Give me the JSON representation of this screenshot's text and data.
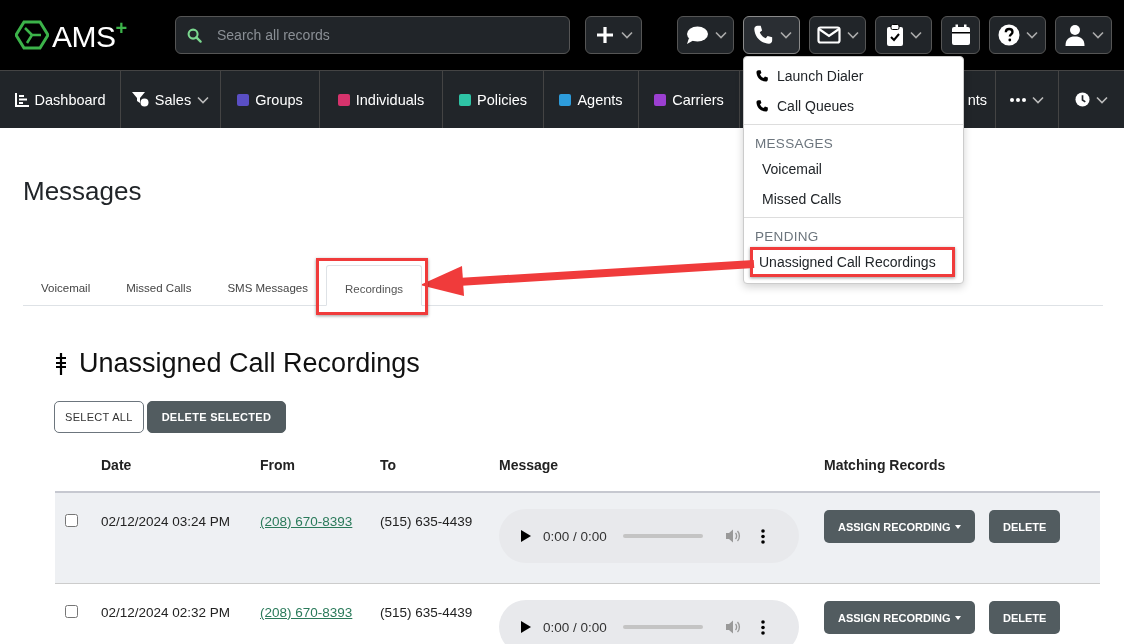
{
  "topbar": {
    "logo": {
      "text": "AMS",
      "sup": "+"
    },
    "search": {
      "placeholder": "Search all records"
    },
    "buttons": [
      {
        "kind": "plus",
        "dropdown": true,
        "expanded": false
      },
      {
        "kind": "chat",
        "dropdown": true,
        "expanded": false
      },
      {
        "kind": "phone",
        "dropdown": true,
        "expanded": true
      },
      {
        "kind": "mail",
        "dropdown": true,
        "expanded": false
      },
      {
        "kind": "clipboard",
        "dropdown": true,
        "expanded": false
      },
      {
        "kind": "calendar",
        "dropdown": false,
        "expanded": false
      },
      {
        "kind": "help",
        "dropdown": true,
        "expanded": false
      },
      {
        "kind": "user",
        "dropdown": true,
        "expanded": false
      }
    ]
  },
  "nav": [
    {
      "kind": "chart",
      "label": "Dashboard",
      "dropdown": false
    },
    {
      "kind": "funnel",
      "label": "Sales",
      "dropdown": true
    },
    {
      "kind": "swatch",
      "label": "Groups",
      "color": "#5a4fc4",
      "dropdown": false
    },
    {
      "kind": "swatch",
      "label": "Individuals",
      "color": "#d6336c",
      "dropdown": false
    },
    {
      "kind": "swatch",
      "label": "Policies",
      "color": "#2ec4a5",
      "dropdown": false
    },
    {
      "kind": "swatch",
      "label": "Agents",
      "color": "#2d9cdb",
      "dropdown": false
    },
    {
      "kind": "swatch",
      "label": "Carriers",
      "color": "#9b3fd1",
      "dropdown": false
    },
    {
      "kind": "text",
      "label": "nts",
      "dropdown": false
    },
    {
      "kind": "more",
      "dropdown": true
    },
    {
      "kind": "clock",
      "dropdown": true
    }
  ],
  "menu": {
    "sections": [
      {
        "items": [
          {
            "label": "Launch Dialer",
            "icon": true,
            "annotated": false
          },
          {
            "label": "Call Queues",
            "icon": true,
            "annotated": false
          }
        ]
      },
      {
        "header": "MESSAGES",
        "items": [
          {
            "label": "Voicemail",
            "icon": false,
            "annotated": false
          },
          {
            "label": "Missed Calls",
            "icon": false,
            "annotated": false
          }
        ]
      },
      {
        "header": "PENDING",
        "items": [
          {
            "label": "Unassigned Call Recordings",
            "icon": false,
            "annotated": true
          }
        ]
      }
    ]
  },
  "page": {
    "title": "Messages",
    "tabs": [
      {
        "label": "Voicemail",
        "selected": false,
        "annotated": false
      },
      {
        "label": "Missed Calls",
        "selected": false,
        "annotated": false
      },
      {
        "label": "SMS Messages",
        "selected": false,
        "annotated": false
      },
      {
        "label": "Recordings",
        "selected": true,
        "annotated": true
      }
    ],
    "heading": "Unassigned Call Recordings",
    "actions": [
      {
        "label": "SELECT ALL",
        "kind": "outline"
      },
      {
        "label": "DELETE SELECTED",
        "kind": "dark"
      }
    ],
    "table": {
      "columns": [
        "Date",
        "From",
        "To",
        "Message",
        "Matching Records"
      ],
      "rows": [
        {
          "checked": false,
          "hovered": true,
          "date": "02/12/2024 03:24 PM",
          "from": "(208) 670-8393",
          "to": "(515) 635-4439",
          "time": "0:00 / 0:00",
          "assign": "ASSIGN RECORDING",
          "delete": "DELETE"
        },
        {
          "checked": false,
          "hovered": false,
          "date": "02/12/2024 02:32 PM",
          "from": "(208) 670-8393",
          "to": "(515) 635-4439",
          "time": "0:00 / 0:00",
          "assign": "ASSIGN RECORDING",
          "delete": "DELETE"
        }
      ]
    }
  }
}
